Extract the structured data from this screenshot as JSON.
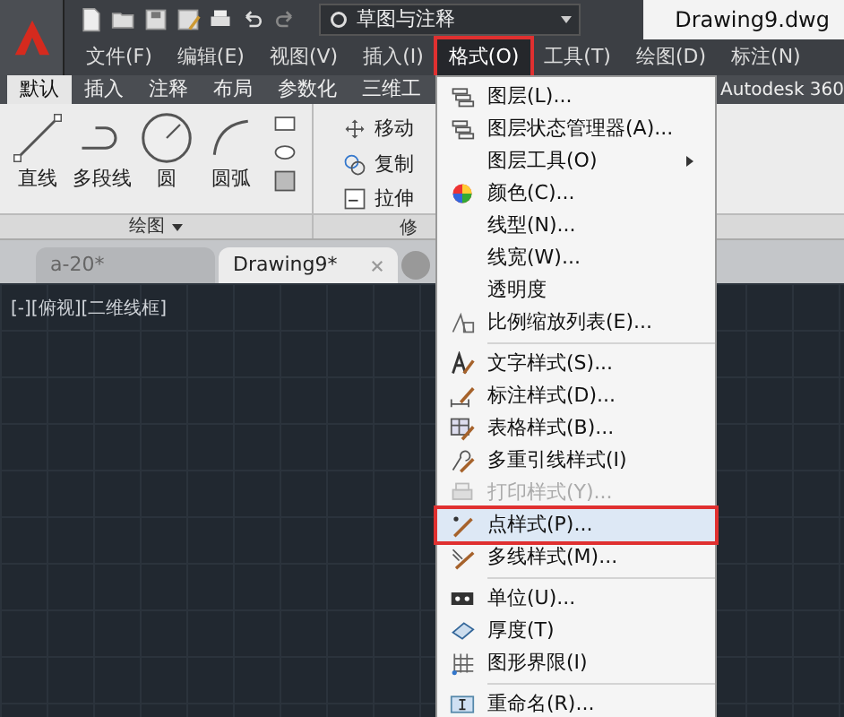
{
  "title": "Drawing9.dwg",
  "workspace": "草图与注释",
  "menu_bar": [
    {
      "label": "文件(F)",
      "selected": false,
      "marked": false
    },
    {
      "label": "编辑(E)",
      "selected": false,
      "marked": false
    },
    {
      "label": "视图(V)",
      "selected": false,
      "marked": false
    },
    {
      "label": "插入(I)",
      "selected": false,
      "marked": false
    },
    {
      "label": "格式(O)",
      "selected": true,
      "marked": true
    },
    {
      "label": "工具(T)",
      "selected": false,
      "marked": false
    },
    {
      "label": "绘图(D)",
      "selected": false,
      "marked": false
    },
    {
      "label": "标注(N)",
      "selected": false,
      "marked": false
    }
  ],
  "ribbon_tabs": [
    {
      "label": "默认",
      "selected": true
    },
    {
      "label": "插入",
      "selected": false
    },
    {
      "label": "注释",
      "selected": false
    },
    {
      "label": "布局",
      "selected": false
    },
    {
      "label": "参数化",
      "selected": false
    },
    {
      "label": "三维工",
      "selected": false
    }
  ],
  "ribbon_tab_right": "Autodesk 360",
  "draw_panel": {
    "tools": [
      "直线",
      "多段线",
      "圆",
      "圆弧"
    ],
    "title": "绘图"
  },
  "modify_panel": {
    "tools": [
      "移动",
      "复制",
      "拉伸"
    ],
    "title": "修"
  },
  "document_tabs": [
    {
      "label": "a-20*",
      "selected": false
    },
    {
      "label": "Drawing9*",
      "selected": true
    }
  ],
  "viewport_label": "[-][俯视][二维线框]",
  "format_menu": [
    {
      "kind": "item",
      "label": "图层(L)...",
      "disabled": false,
      "highlighted": false,
      "marked": false,
      "submenu": false
    },
    {
      "kind": "item",
      "label": "图层状态管理器(A)...",
      "disabled": false,
      "highlighted": false,
      "marked": false,
      "submenu": false
    },
    {
      "kind": "item",
      "label": "图层工具(O)",
      "disabled": false,
      "highlighted": false,
      "marked": false,
      "submenu": true
    },
    {
      "kind": "item",
      "label": "颜色(C)...",
      "disabled": false,
      "highlighted": false,
      "marked": false,
      "submenu": false
    },
    {
      "kind": "item",
      "label": "线型(N)...",
      "disabled": false,
      "highlighted": false,
      "marked": false,
      "submenu": false
    },
    {
      "kind": "item",
      "label": "线宽(W)...",
      "disabled": false,
      "highlighted": false,
      "marked": false,
      "submenu": false
    },
    {
      "kind": "item",
      "label": "透明度",
      "disabled": false,
      "highlighted": false,
      "marked": false,
      "submenu": false
    },
    {
      "kind": "item",
      "label": "比例缩放列表(E)...",
      "disabled": false,
      "highlighted": false,
      "marked": false,
      "submenu": false
    },
    {
      "kind": "separator"
    },
    {
      "kind": "item",
      "label": "文字样式(S)...",
      "disabled": false,
      "highlighted": false,
      "marked": false,
      "submenu": false
    },
    {
      "kind": "item",
      "label": "标注样式(D)...",
      "disabled": false,
      "highlighted": false,
      "marked": false,
      "submenu": false
    },
    {
      "kind": "item",
      "label": "表格样式(B)...",
      "disabled": false,
      "highlighted": false,
      "marked": false,
      "submenu": false
    },
    {
      "kind": "item",
      "label": "多重引线样式(I)",
      "disabled": false,
      "highlighted": false,
      "marked": false,
      "submenu": false
    },
    {
      "kind": "item",
      "label": "打印样式(Y)...",
      "disabled": true,
      "highlighted": false,
      "marked": false,
      "submenu": false
    },
    {
      "kind": "item",
      "label": "点样式(P)...",
      "disabled": false,
      "highlighted": true,
      "marked": true,
      "submenu": false
    },
    {
      "kind": "item",
      "label": "多线样式(M)...",
      "disabled": false,
      "highlighted": false,
      "marked": false,
      "submenu": false
    },
    {
      "kind": "separator"
    },
    {
      "kind": "item",
      "label": "单位(U)...",
      "disabled": false,
      "highlighted": false,
      "marked": false,
      "submenu": false
    },
    {
      "kind": "item",
      "label": "厚度(T)",
      "disabled": false,
      "highlighted": false,
      "marked": false,
      "submenu": false
    },
    {
      "kind": "item",
      "label": "图形界限(I)",
      "disabled": false,
      "highlighted": false,
      "marked": false,
      "submenu": false
    },
    {
      "kind": "separator"
    },
    {
      "kind": "item",
      "label": "重命名(R)...",
      "disabled": false,
      "highlighted": false,
      "marked": false,
      "submenu": false
    }
  ]
}
